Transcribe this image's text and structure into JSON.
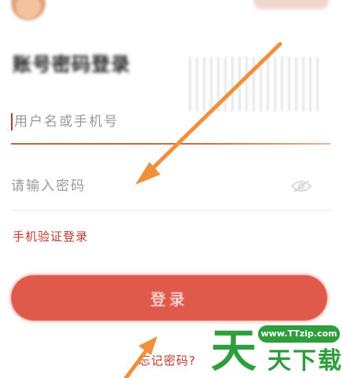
{
  "top_bar": {
    "obscured_text": ""
  },
  "form": {
    "title": "账号密码登录",
    "username_placeholder": "用户名或手机号",
    "password_placeholder": "请输入密码",
    "sms_login_link": "手机验证登录",
    "login_button": "登录",
    "forgot_password": "忘记密码?"
  },
  "watermark": {
    "url": "www.TTzip.com",
    "big_char": "天",
    "small_text": "天下载"
  },
  "colors": {
    "accent": "#e05a4c",
    "link": "#c0392b",
    "annotation_arrow": "#f0903c",
    "watermark_green": "#2e9e3c"
  },
  "icons": {
    "password_toggle": "eye-slash-icon",
    "annotation": "arrow-icon"
  }
}
